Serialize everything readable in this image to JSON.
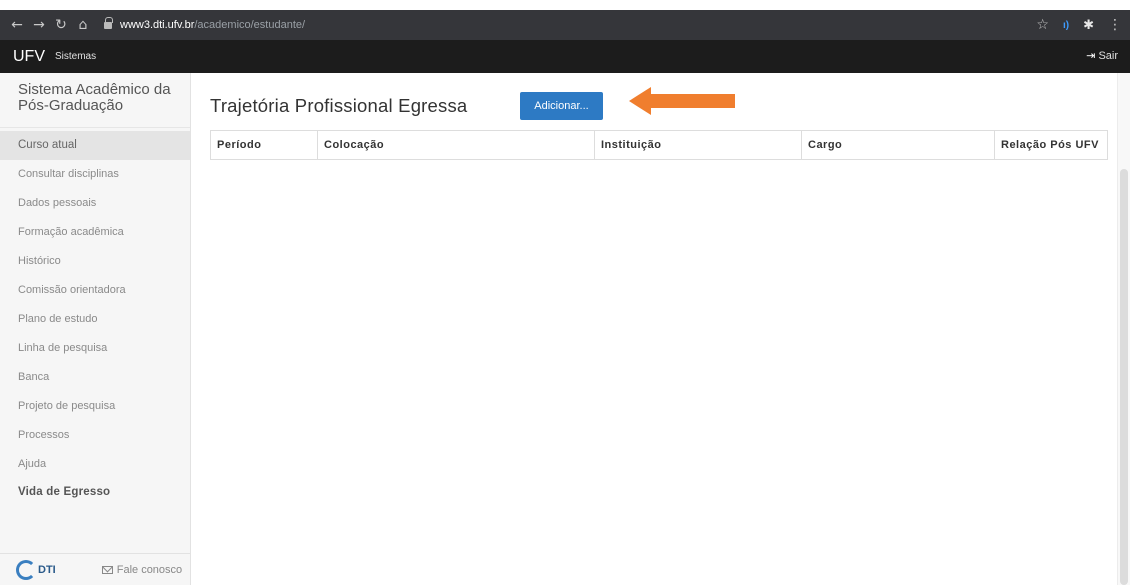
{
  "browser": {
    "url_host": "www3.dti.ufv.br",
    "url_path": "/academico/estudante/",
    "icons": [
      "back-icon",
      "forward-icon",
      "reload-icon",
      "home-icon",
      "lock-icon",
      "star-icon",
      "extension-icon",
      "puzzle-icon",
      "menu-icon"
    ]
  },
  "navbar": {
    "brand": "UFV",
    "sistemas": "Sistemas",
    "sair": "Sair",
    "background": "#1c1c1c"
  },
  "sidebar": {
    "title": "Sistema Acadêmico da Pós-Graduação",
    "items": [
      {
        "label": "Curso atual"
      },
      {
        "label": "Consultar disciplinas"
      },
      {
        "label": "Dados pessoais"
      },
      {
        "label": "Formação acadêmica"
      },
      {
        "label": "Histórico"
      },
      {
        "label": "Comissão orientadora"
      },
      {
        "label": "Plano de estudo"
      },
      {
        "label": "Linha de pesquisa"
      },
      {
        "label": "Banca"
      },
      {
        "label": "Projeto de pesquisa"
      },
      {
        "label": "Processos"
      },
      {
        "label": "Ajuda"
      },
      {
        "label": "Vida de Egresso"
      }
    ],
    "footer": {
      "logo_text": "DTI",
      "contact": "Fale conosco"
    }
  },
  "main": {
    "title": "Trajetória Profissional Egressa",
    "add_button": "Adicionar...",
    "button_color": "#2d7ac4",
    "annotation_arrow_color": "#f07e2e",
    "table": {
      "columns": [
        "Período",
        "Colocação",
        "Instituição",
        "Cargo",
        "Relação Pós UFV"
      ],
      "rows": []
    }
  }
}
